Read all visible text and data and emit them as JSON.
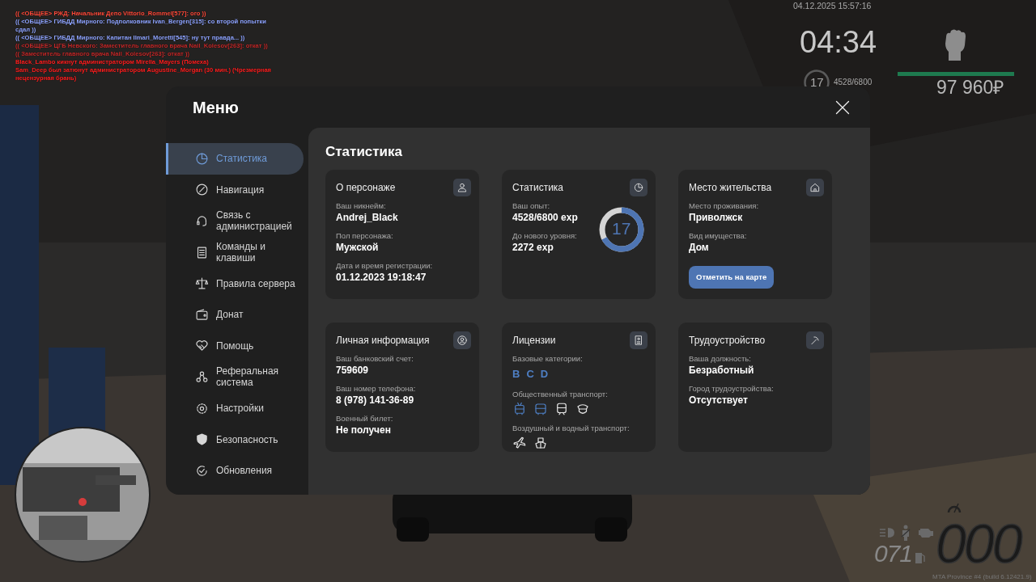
{
  "chat": [
    {
      "text": "(( <ОБЩЕЕ> РЖД: Начальник Депо Vittorio_Rommel[577]: ого ))",
      "color": "#ff4a3a"
    },
    {
      "text": "(( <ОБЩЕЕ> ГИБДД Мирного: Подполковник Ivan_Bergen[315]: со второй попытки сдал ))",
      "color": "#8fa4ff"
    },
    {
      "text": "(( <ОБЩЕЕ> ГИБДД Мирного: Капитан Ilmari_Moretti[545]: ну тут правда... ))",
      "color": "#8fa4ff"
    },
    {
      "text": "(( <ОБЩЕЕ> ЦГБ Невского: Заместитель главного врача Nail_Kolesov[263]: откат ))",
      "color": "#c42a2a"
    },
    {
      "text": "(( Заместитель главного врача Nail_Kolesov[263]: откат ))",
      "color": "#c42a2a"
    },
    {
      "text": "Black_Lambo кикнут администратором Mirella_Mayers (Помеха)",
      "color": "#ff2020"
    },
    {
      "text": "Sam_Deep был затюнут администратором Augustine_Morgan (30 мин.) (Чрезмерная нецензурная брань)",
      "color": "#ff2020"
    }
  ],
  "hud": {
    "datetime": "04.12.2025 15:57:16",
    "clock": "04:34",
    "level_ring": {
      "label": "17"
    },
    "xp": "4528/6800",
    "health": {
      "level": 1.0
    },
    "money": "97 960₽"
  },
  "menu": {
    "title": "Меню",
    "sidebar": [
      {
        "label": "Статистика",
        "selected": true
      },
      {
        "label": "Навигация",
        "selected": false
      },
      {
        "label": "Связь с администрацией",
        "selected": false
      },
      {
        "label": "Команды и клавиши",
        "selected": false
      },
      {
        "label": "Правила сервера",
        "selected": false
      },
      {
        "label": "Донат",
        "selected": false
      },
      {
        "label": "Помощь",
        "selected": false
      },
      {
        "label": "Реферальная система",
        "selected": false
      },
      {
        "label": "Настройки",
        "selected": false
      },
      {
        "label": "Безопасность",
        "selected": false
      },
      {
        "label": "Обновления",
        "selected": false
      }
    ],
    "page_title": "Статистика",
    "cards": [
      {
        "kind": "info",
        "title": "О персонаже",
        "fields": [
          {
            "label": "Ваш никнейм:",
            "value": "Andrej_Black"
          },
          {
            "label": "Пол персонажа:",
            "value": "Мужской"
          },
          {
            "label": "Дата и время регистрации:",
            "value": "01.12.2023 19:18:47"
          }
        ]
      },
      {
        "kind": "progress",
        "title": "Статистика",
        "fields": [
          {
            "label": "Ваш опыт:",
            "value": "4528/6800 exp"
          },
          {
            "label": "До нового уровня:",
            "value": "2272 exp"
          }
        ],
        "ring": {
          "label": "17",
          "level": 0.67
        }
      },
      {
        "kind": "action",
        "title": "Место жительства",
        "fields": [
          {
            "label": "Место проживания:",
            "value": "Приволжск"
          },
          {
            "label": "Вид имущества:",
            "value": "Дом"
          }
        ],
        "button": "Отметить на карте"
      },
      {
        "kind": "info",
        "title": "Личная информация",
        "fields": [
          {
            "label": "Ваш банковский счет:",
            "value": "759609"
          },
          {
            "label": "Ваш номер телефона:",
            "value": "8 (978) 141-36-89"
          },
          {
            "label": "Военный билет:",
            "value": "Не получен"
          }
        ]
      },
      {
        "kind": "licenses",
        "title": "Лицензии",
        "groups": [
          {
            "kind": "letters",
            "label": "Базовые категории:",
            "items": [
              {
                "text": "B",
                "held": true
              },
              {
                "text": "C",
                "held": true
              },
              {
                "text": "D",
                "held": true
              }
            ]
          },
          {
            "kind": "icons",
            "label": "Общественный транспорт:",
            "items": [
              {
                "held": true
              },
              {
                "held": true
              },
              {
                "held": false
              },
              {
                "held": false
              }
            ]
          },
          {
            "kind": "icons",
            "label": "Воздушный и водный транспорт:",
            "items": [
              {
                "held": false
              },
              {
                "held": false
              }
            ]
          }
        ]
      },
      {
        "kind": "info",
        "title": "Трудоустройство",
        "fields": [
          {
            "label": "Ваша должность:",
            "value": "Безработный"
          },
          {
            "label": "Город трудоустройства:",
            "value": "Отсутствует"
          }
        ]
      }
    ]
  },
  "vehicle": {
    "fuel": "071",
    "speed": "000"
  },
  "footer": "MTA Province #4 (build 6.12421.9)"
}
